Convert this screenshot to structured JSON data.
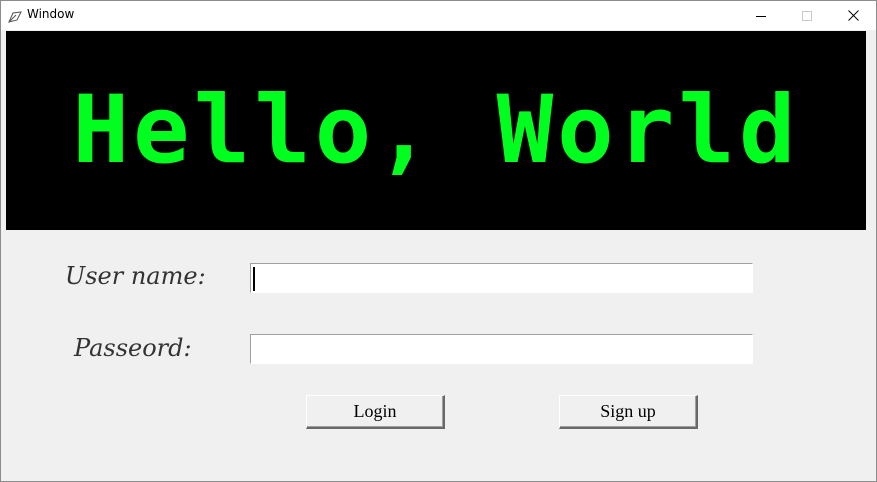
{
  "window": {
    "title": "Window",
    "icon": "feather-icon",
    "controls": [
      "minimize-icon",
      "maximize-icon",
      "close-icon"
    ]
  },
  "banner": {
    "text": "Hello, World",
    "text_color": "#00ff1e",
    "background": "#000000"
  },
  "form": {
    "username_label": "User name:",
    "username_value": "",
    "password_label": "Passeord:",
    "password_value": ""
  },
  "buttons": {
    "login_label": "Login",
    "signup_label": "Sign up"
  }
}
